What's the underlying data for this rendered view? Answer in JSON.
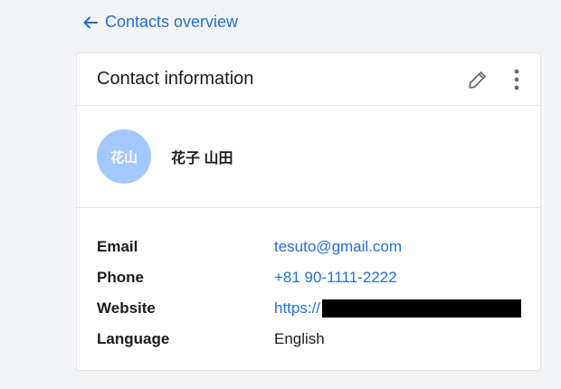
{
  "back_link": {
    "label": "Contacts overview"
  },
  "card": {
    "title": "Contact information",
    "actions": {
      "edit_icon": "pencil-icon",
      "more_icon": "kebab-menu-icon"
    }
  },
  "profile": {
    "avatar_initials": "花山",
    "full_name": "花子 山田",
    "avatar_color": "#a3c8fb"
  },
  "details": {
    "email": {
      "label": "Email",
      "value": "tesuto@gmail.com"
    },
    "phone": {
      "label": "Phone",
      "value": "+81 90-1111-2222"
    },
    "website": {
      "label": "Website",
      "value": "https://"
    },
    "language": {
      "label": "Language",
      "value": "English"
    }
  },
  "colors": {
    "link": "#1f6fd6",
    "background": "#f3f4f6",
    "card": "#ffffff"
  }
}
